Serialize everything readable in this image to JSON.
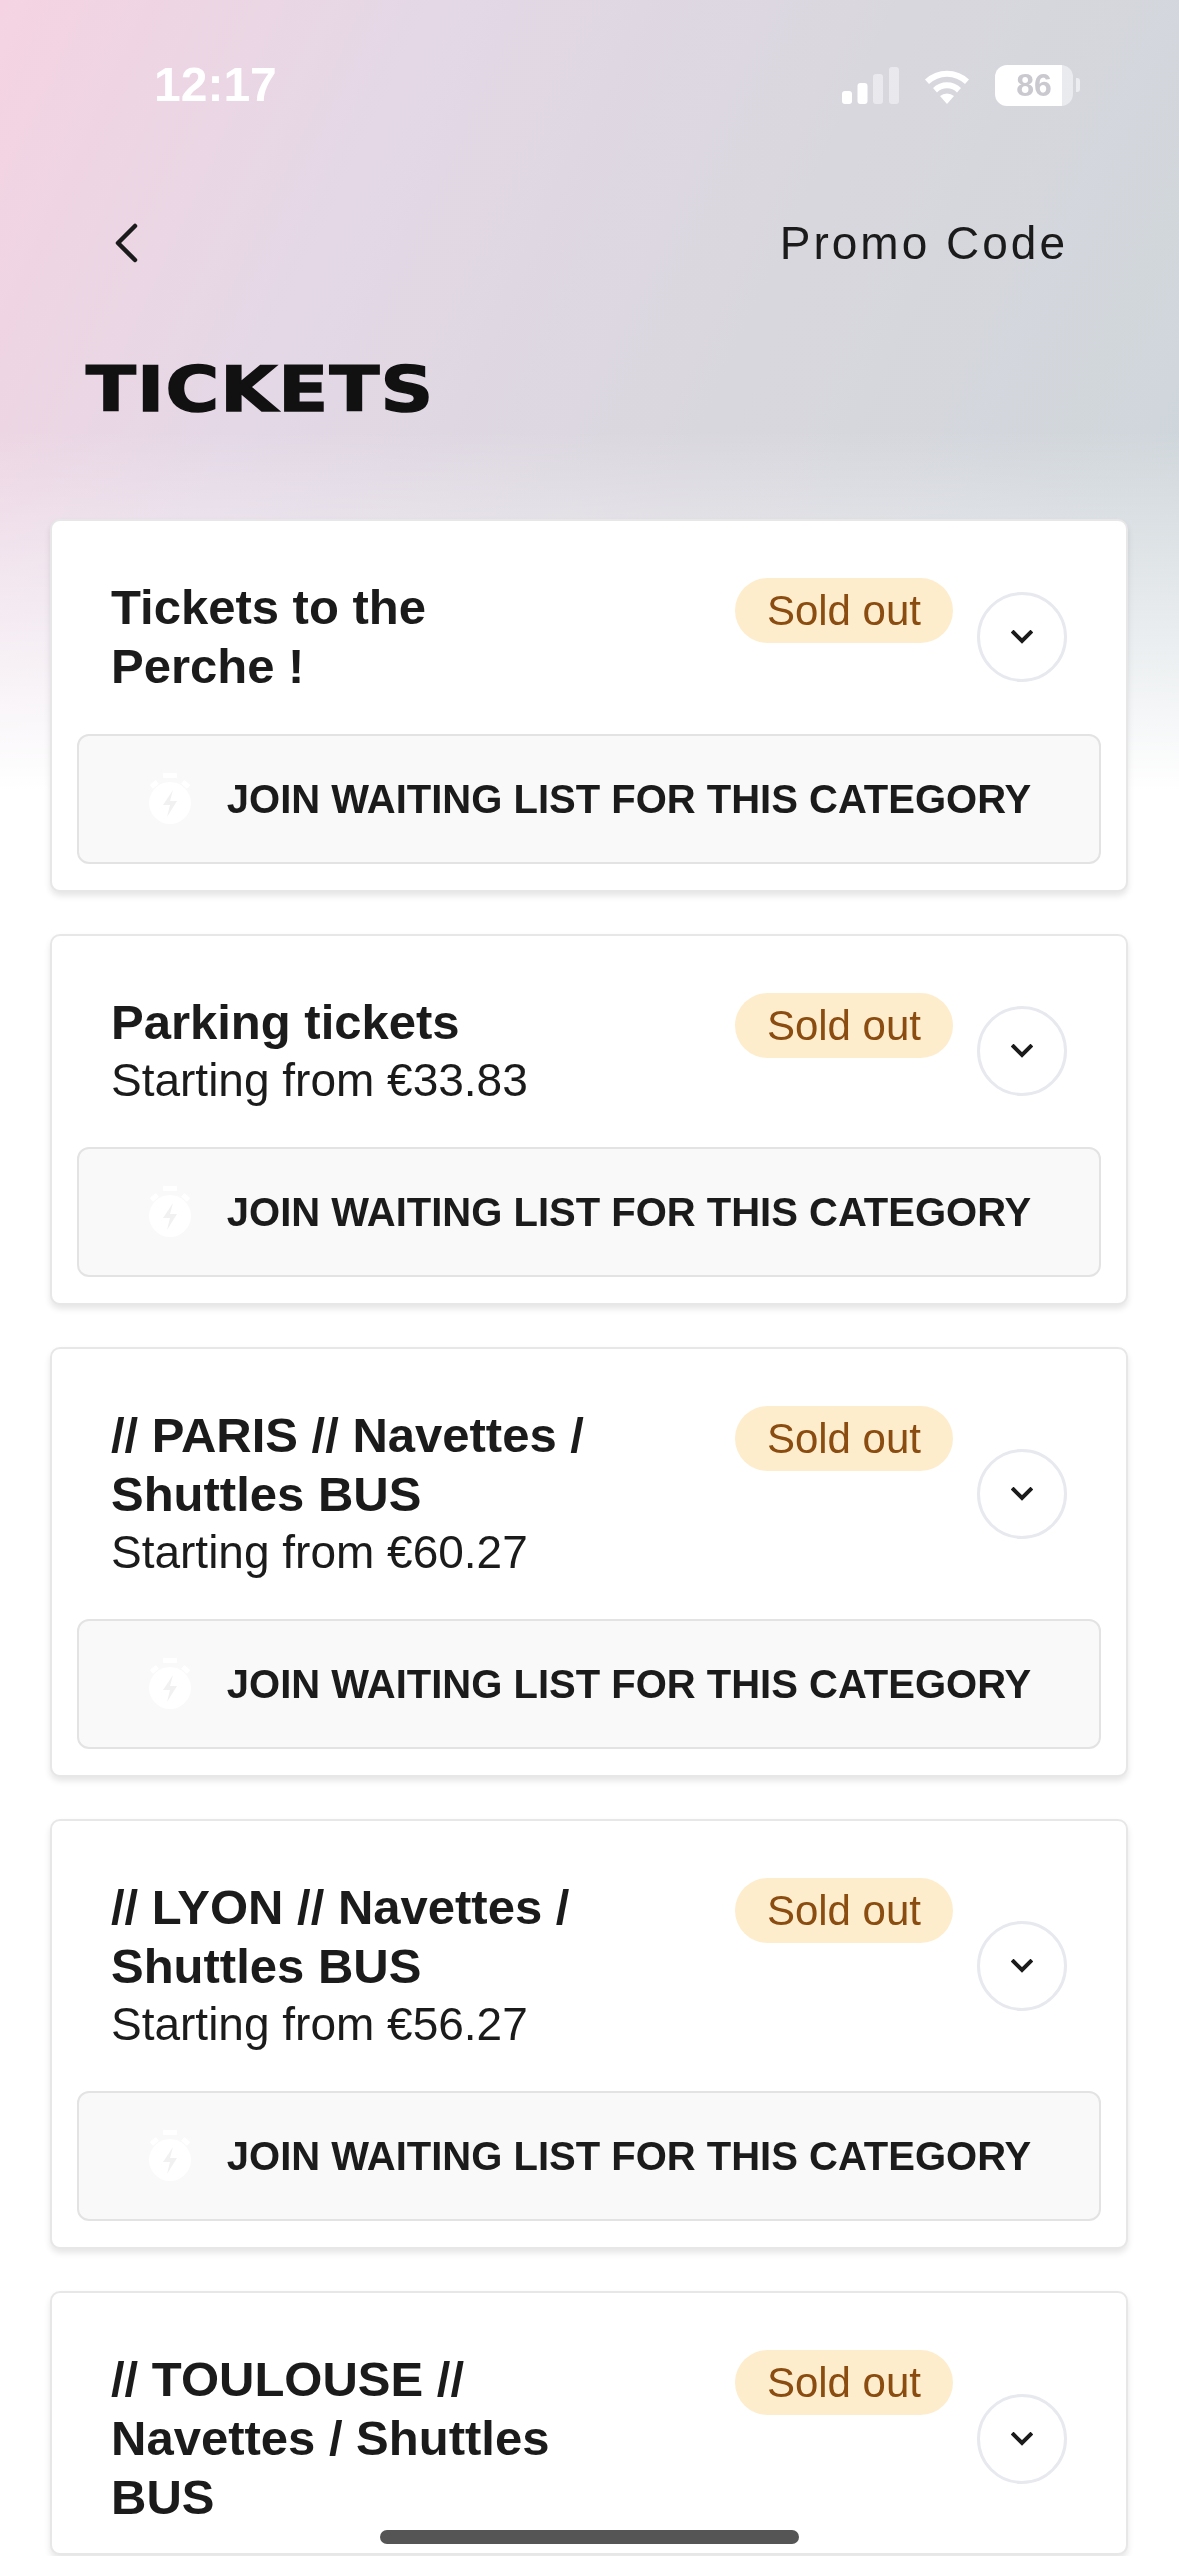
{
  "status_bar": {
    "time": "12:17",
    "battery": "86"
  },
  "header": {
    "promo_link": "Promo Code"
  },
  "title": "TICKETS",
  "categories": [
    {
      "name": "Tickets to the Perche !",
      "badge": "Sold out",
      "expanded": false,
      "waiting_list_button": "JOIN WAITING LIST FOR THIS CATEGORY"
    },
    {
      "name": "Parking tickets",
      "price": "Starting from €33.83",
      "badge": "Sold out",
      "expanded": false,
      "waiting_list_button": "JOIN WAITING LIST FOR THIS CATEGORY"
    },
    {
      "name": "// PARIS // Navettes / Shuttles BUS",
      "price": "Starting from €60.27",
      "badge": "Sold out",
      "expanded": false,
      "waiting_list_button": "JOIN WAITING LIST FOR THIS CATEGORY"
    },
    {
      "name": "// LYON // Navettes / Shuttles BUS",
      "price": "Starting from €56.27",
      "badge": "Sold out",
      "expanded": false,
      "waiting_list_button": "JOIN WAITING LIST FOR THIS CATEGORY"
    },
    {
      "name": "// TOULOUSE // Navettes / Shuttles BUS",
      "badge": "Sold out",
      "expanded": false
    }
  ]
}
